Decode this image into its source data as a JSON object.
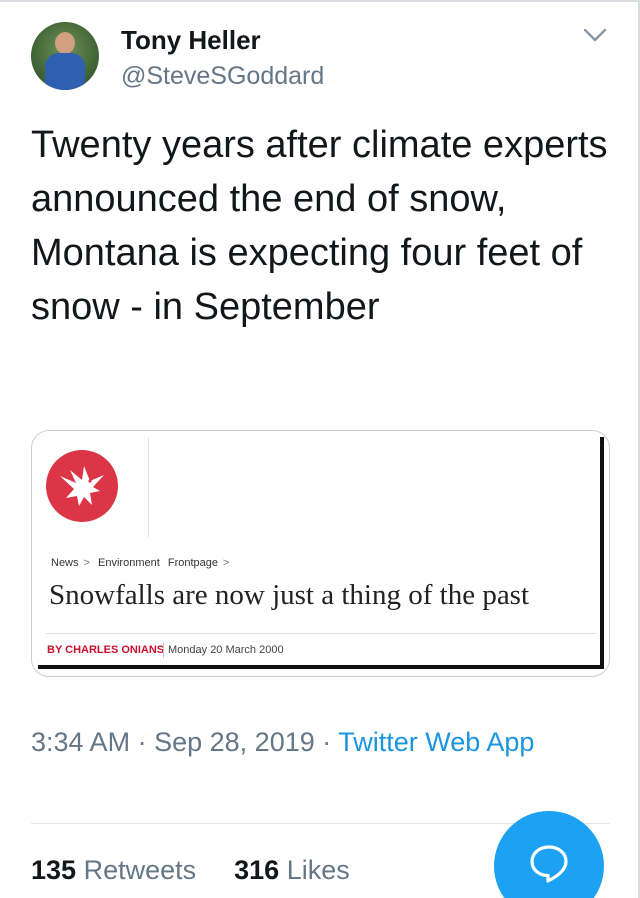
{
  "user": {
    "display_name": "Tony Heller",
    "handle": "@SteveSGoddard"
  },
  "tweet": {
    "text": "Twenty years after climate experts announced the end of snow, Montana is expecting four feet of snow - in September"
  },
  "attached_image": {
    "breadcrumb": [
      "News",
      "Environment",
      "Frontpage"
    ],
    "headline": "Snowfalls are now just a thing of the past",
    "byline": "BY CHARLES ONIANS",
    "date": "Monday 20 March 2000"
  },
  "meta": {
    "time": "3:34 AM",
    "date": "Sep 28, 2019",
    "separator": "·",
    "source": "Twitter Web App"
  },
  "stats": {
    "retweets_count": "135",
    "retweets_label": "Retweets",
    "likes_count": "316",
    "likes_label": "Likes"
  },
  "icons": {
    "menu": "chevron-down-icon",
    "compose": "speech-bubble-icon",
    "logo": "independent-eagle-logo"
  },
  "colors": {
    "accent": "#1da1f2",
    "link": "#1b95e0",
    "secondary_text": "#657786",
    "logo_red": "#dc3545",
    "byline_red": "#c8102e"
  }
}
